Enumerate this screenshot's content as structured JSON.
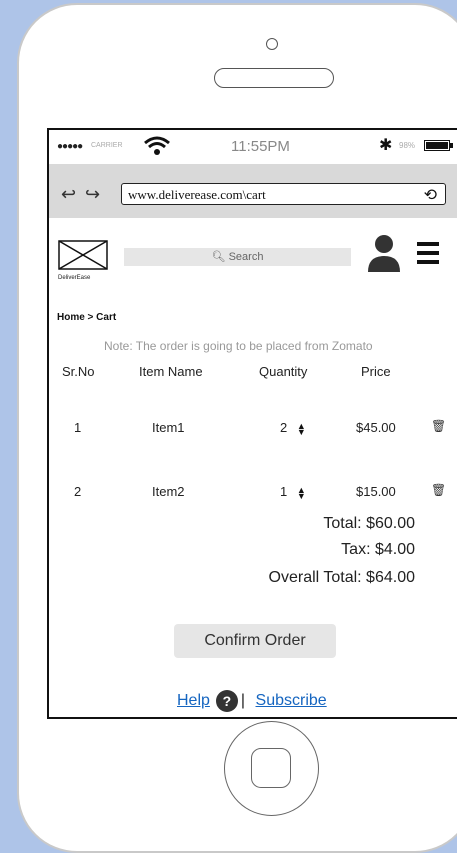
{
  "status_bar": {
    "carrier": "CARRIER",
    "time": "11:55PM",
    "battery_percent": "98%"
  },
  "browser": {
    "url": "www.deliverease.com\\cart"
  },
  "header": {
    "logo_label": "DeliverEase",
    "search_placeholder": "Search"
  },
  "breadcrumb": "Home > Cart",
  "note": "Note: The order is going to be placed from Zomato",
  "table": {
    "headers": [
      "Sr.No",
      "Item Name",
      "Quantity",
      "Price"
    ],
    "rows": [
      {
        "sr": "1",
        "name": "Item1",
        "qty": "2",
        "price": "$45.00"
      },
      {
        "sr": "2",
        "name": "Item2",
        "qty": "1",
        "price": "$15.00"
      }
    ]
  },
  "totals": {
    "total": "Total:  $60.00",
    "tax": "Tax:  $4.00",
    "overall": "Overall Total: $64.00"
  },
  "confirm_label": "Confirm Order",
  "footer": {
    "help": "Help",
    "separator": "|",
    "subscribe": "Subscribe"
  },
  "colors": {
    "background": "#aec4e8",
    "link": "#1565c0"
  }
}
